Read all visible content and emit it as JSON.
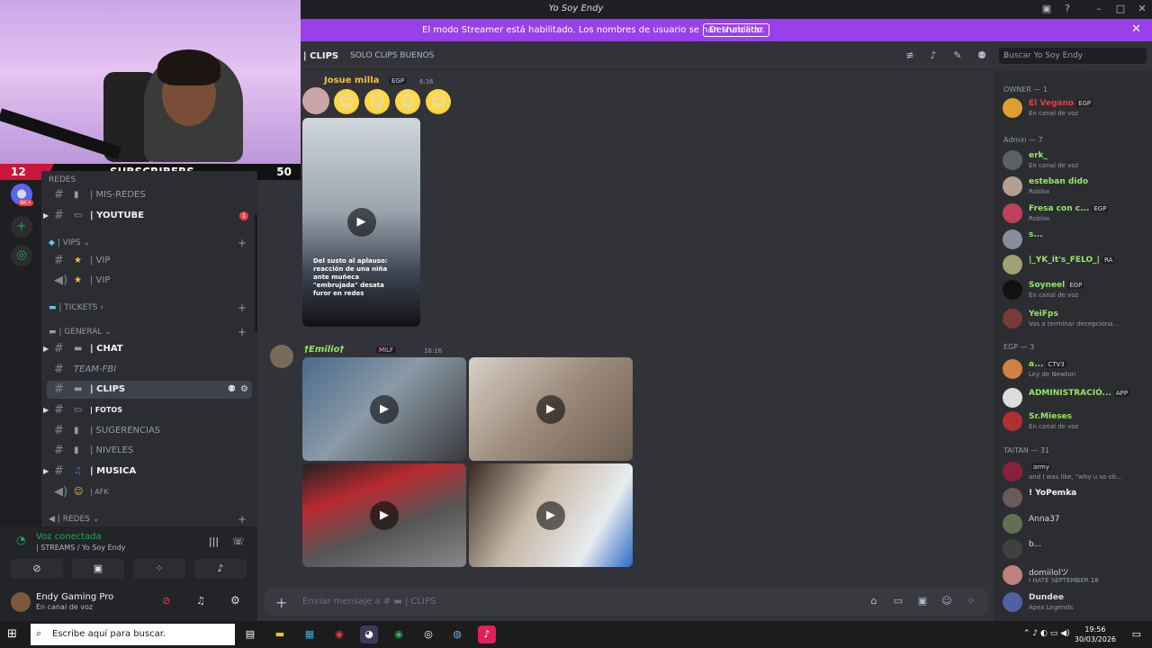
{
  "window": {
    "title": "Yo Soy Endy"
  },
  "banner": {
    "message": "El modo Streamer está habilitado. Los nombres de usuario se han truncado.",
    "button": "Deshabilitar"
  },
  "overlay": {
    "left_count": "12",
    "label": "SUBSCRIBERS",
    "right_count": "50"
  },
  "servers": {
    "badge1": "9K+"
  },
  "channels": {
    "redes_top": "REDES",
    "mis_redes": "| MIS-REDES",
    "youtube": "| YOUTUBE",
    "youtube_badge": "1",
    "vips_cat": "| VIPS",
    "vip1": "| VIP",
    "vip2": "| VIP",
    "tickets": "| TICKETS",
    "general_cat": "| GENERAL",
    "chat": "| CHAT",
    "team": "TEAM-FBI",
    "clips": "| CLIPS",
    "fotos": "| FOTOS",
    "sugerencias": "| SUGERENCIAS",
    "niveles": "| NIVELES",
    "musica": "| MUSICA",
    "afk": "| AFK",
    "redes_cat": "| REDES"
  },
  "voice": {
    "status": "Voz conectada",
    "channel": "| STREAMS / Yo Soy Endy"
  },
  "user": {
    "name": "Endy Gaming Pro",
    "status": "En canal de voz"
  },
  "header": {
    "channel": "| CLIPS",
    "topic": "SOLO CLIPS BUENOS",
    "search_placeholder": "Buscar Yo Soy Endy"
  },
  "messages": [
    {
      "author": "Josue milla",
      "tag": "EGP",
      "time": "6:36",
      "caption": "Del susto al aplauso: reacción de una niña ante muñeca \"embrujada\" desata furor en redes",
      "color": "#f0c040"
    },
    {
      "author": "†Emilio†",
      "tag": "MILF",
      "time": "16:16",
      "color": "#9be564"
    }
  ],
  "composer": {
    "placeholder": "Enviar mensaje a #",
    "channel": "| CLIPS"
  },
  "members": {
    "owner_group": "OWNER — 1",
    "admin_group": "Admin — 7",
    "egp_group": "EGP — 3",
    "taitan_group": "TAITAN — 31",
    "list": [
      {
        "name": "El Vegano",
        "tag": "EGP",
        "activity": "En canal de voz",
        "color": "#e04040"
      },
      {
        "name": "erk_",
        "activity": "En canal de voz",
        "color": "#9be564"
      },
      {
        "name": "esteban dido",
        "activity": "Roblox",
        "color": "#9be564"
      },
      {
        "name": "Fresa con c...",
        "tag": "EGP",
        "activity": "Roblox",
        "color": "#9be564"
      },
      {
        "name": "s...",
        "activity": "",
        "color": "#9be564"
      },
      {
        "name": "|_YK_it's_FELO_|",
        "tag": "RA",
        "activity": "",
        "color": "#9be564"
      },
      {
        "name": "Soyneel",
        "tag": "EGP",
        "activity": "En canal de voz",
        "color": "#9be564"
      },
      {
        "name": "YeiFps",
        "activity": "Vas a terminar decepciona...",
        "color": "#9be564"
      },
      {
        "name": "a...",
        "tag": "CTV3",
        "activity": "Ley de Newton",
        "color": "#9be564"
      },
      {
        "name": "ADMINISTRACIÓ...",
        "tag": "APP",
        "activity": "",
        "color": "#9be564"
      },
      {
        "name": "Sr.Mieses",
        "activity": "En canal de voz",
        "color": "#9be564"
      },
      {
        "name": "",
        "tag": "army",
        "activity": "and I was like, \"why u so ob...",
        "color": "#5865f2"
      },
      {
        "name": "! YoPemka",
        "activity": "",
        "color": "#f2f3f5"
      },
      {
        "name": "Anna37",
        "activity": "",
        "color": "#dbdee1"
      },
      {
        "name": "b...",
        "activity": "",
        "color": "#dbdee1"
      },
      {
        "name": "domiilolツ",
        "activity": "I HATE SEPTEMBER 18",
        "color": "#dbdee1"
      },
      {
        "name": "Dundee",
        "activity": "Apex Legends",
        "color": "#dbdee1"
      }
    ]
  },
  "taskbar": {
    "search": "Escribe aquí para buscar.",
    "time": "19:56",
    "date": "30/03/2026"
  }
}
